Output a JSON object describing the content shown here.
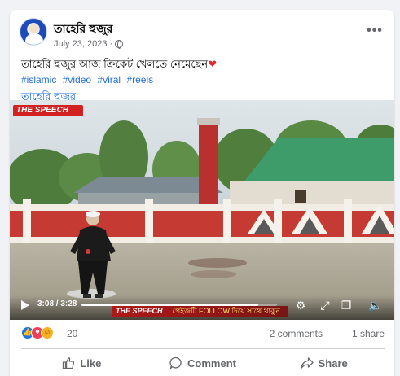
{
  "post": {
    "page_name": "তাহেরি হুজুর",
    "date": "July 23, 2023",
    "date_separator": "·",
    "caption": "তাহেরি হুজুর আজ ক্রিকেট খেলতে নেমেছেন",
    "hashtags": [
      "#islamic",
      "#video",
      "#viral",
      "#reels"
    ],
    "link_text": "তাহেরি হুজুর"
  },
  "video": {
    "brand_top": "THE SPEECH",
    "brand_bottom": "THE SPEECH",
    "follow_text": "পেইজটি FOLLOW দিয়ে সাথে থাকুন",
    "current_time": "3:08",
    "duration": "3:28",
    "time_display": "3:08 / 3:28",
    "progress_fraction": 0.904
  },
  "engagement": {
    "reaction_count": "20",
    "comments_label": "2 comments",
    "shares_label": "1 share"
  },
  "actions": {
    "like_label": "Like",
    "comment_label": "Comment",
    "share_label": "Share"
  },
  "colors": {
    "link": "#216fdb",
    "like_reaction": "#1b74e4",
    "love_reaction": "#f33e58",
    "care_reaction": "#f7b125",
    "brand_red": "#d32020"
  },
  "icons": {
    "privacy": "globe-icon",
    "more": "more-options-icon",
    "like": "thumbs-up-icon",
    "comment": "comment-bubble-icon",
    "share": "share-arrow-icon"
  }
}
